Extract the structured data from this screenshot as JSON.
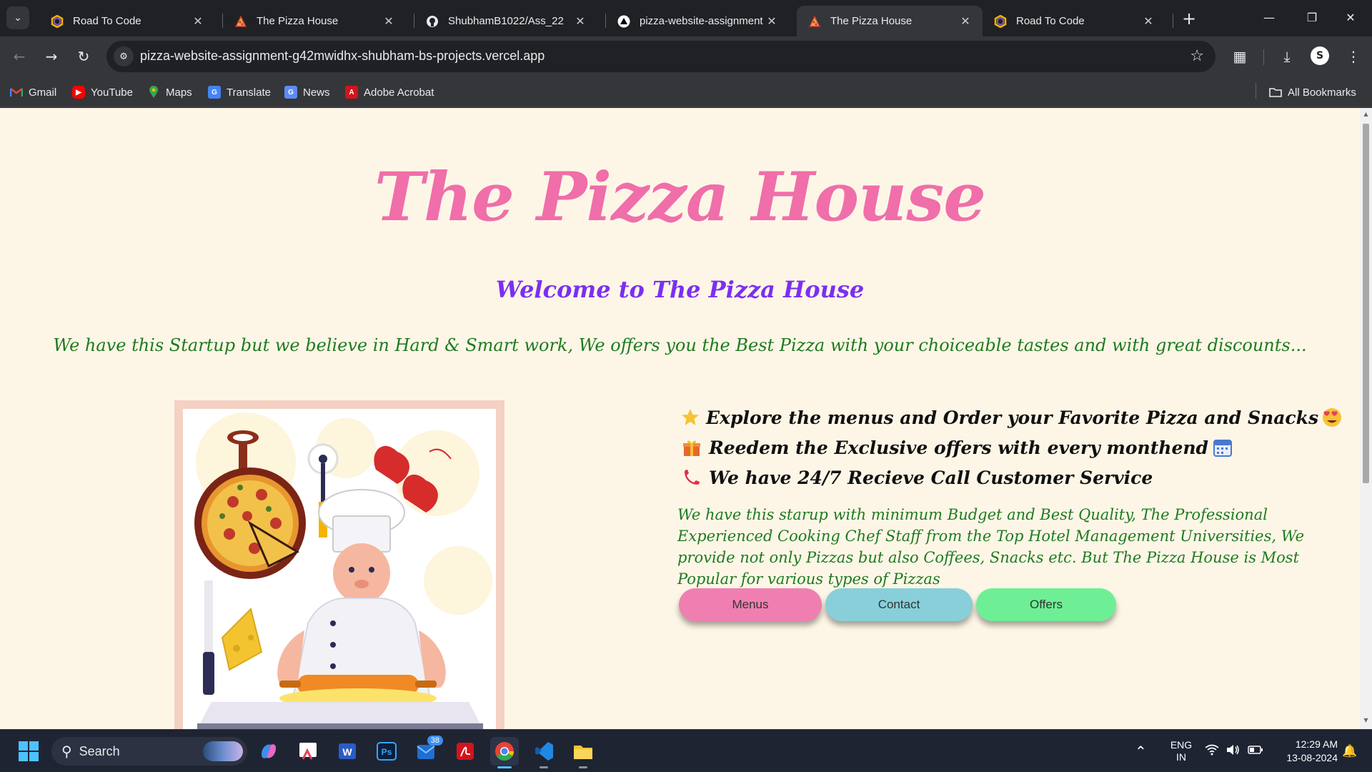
{
  "browser": {
    "tabs": [
      {
        "title": "Road To Code",
        "icon": "road-to-code-icon",
        "active": false
      },
      {
        "title": "The Pizza House",
        "icon": "pizza-icon",
        "active": false
      },
      {
        "title": "ShubhamB1022/Ass_22",
        "icon": "github-icon",
        "active": false
      },
      {
        "title": "pizza-website-assignment",
        "icon": "vercel-icon",
        "active": false
      },
      {
        "title": "The Pizza House",
        "icon": "pizza-icon",
        "active": true
      },
      {
        "title": "Road To Code",
        "icon": "road-to-code-icon",
        "active": false
      }
    ],
    "url": "pizza-website-assignment-g42mwidhx-shubham-bs-projects.vercel.app",
    "profile_initial": "S",
    "bookmarks": [
      {
        "label": "Gmail",
        "icon": "gmail-icon"
      },
      {
        "label": "YouTube",
        "icon": "youtube-icon"
      },
      {
        "label": "Maps",
        "icon": "maps-icon"
      },
      {
        "label": "Translate",
        "icon": "translate-icon"
      },
      {
        "label": "News",
        "icon": "news-icon"
      },
      {
        "label": "Adobe Acrobat",
        "icon": "acrobat-icon"
      }
    ],
    "all_bookmarks_label": "All Bookmarks"
  },
  "page": {
    "brand_title": "The Pizza House",
    "welcome": "Welcome to The Pizza House",
    "tagline": "We have this Startup but we believe in Hard & Smart work, We offers you the Best Pizza with your choiceable tastes and with great discounts...",
    "features": [
      {
        "text": "Explore the menus and Order your Favorite Pizza and Snacks",
        "lead_icon": "star-icon",
        "trail_icon": "heart-eyes-icon"
      },
      {
        "text": "Reedem the Exclusive offers with every monthend",
        "lead_icon": "gift-icon",
        "trail_icon": "calendar-icon"
      },
      {
        "text": "We have 24/7 Recieve Call Customer Service",
        "lead_icon": "phone-icon",
        "trail_icon": ""
      }
    ],
    "about": "We have this starup with minimum Budget and Best Quality, The Professional Experienced Cooking Chef Staff from the Top Hotel Management Universities, We provide not only Pizzas but also Coffees, Snacks etc. But The Pizza House is Most Popular for various types of Pizzas",
    "buttons": [
      {
        "label": "Menus",
        "color": "#f07fb1"
      },
      {
        "label": "Contact",
        "color": "#88cfd9"
      },
      {
        "label": "Offers",
        "color": "#6eef95"
      }
    ],
    "colors": {
      "background": "#fdf6e7",
      "brand": "#f06ea9",
      "welcome": "#7b2ff2",
      "tagline": "#1f7a1f"
    }
  },
  "taskbar": {
    "search_label": "Search",
    "mail_badge": "38",
    "language": "ENG",
    "region": "IN",
    "time": "12:29 AM",
    "date": "13-08-2024"
  }
}
